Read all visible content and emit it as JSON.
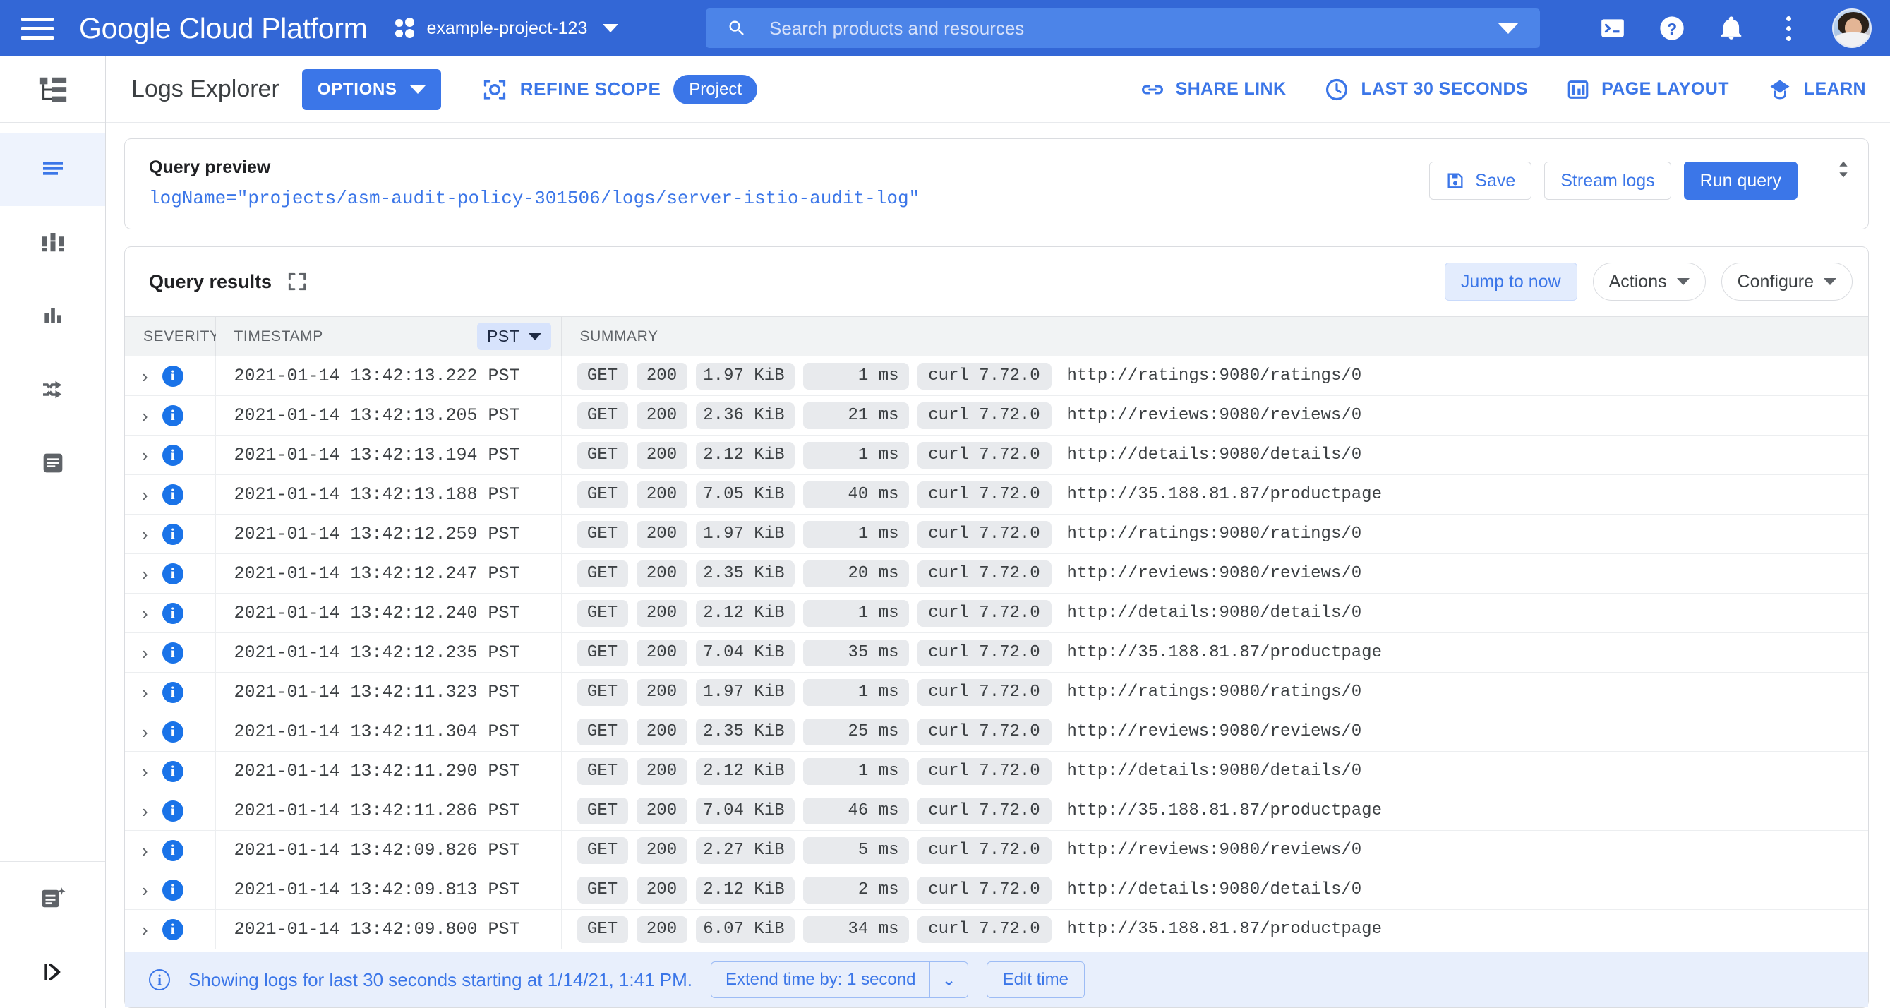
{
  "topbar": {
    "menu_icon": "hamburger-icon",
    "brand": "Google Cloud Platform",
    "project_name": "example-project-123",
    "project_icon": "project-dots-icon",
    "search": {
      "icon": "search-icon",
      "placeholder": "Search products and resources",
      "value": ""
    },
    "icons": [
      {
        "name": "cloud-shell-icon"
      },
      {
        "name": "help-icon"
      },
      {
        "name": "notifications-bell-icon"
      },
      {
        "name": "more-options-kebab-icon"
      },
      {
        "name": "user-avatar"
      }
    ]
  },
  "sidebar": {
    "top_icon": "resource-hierarchy-icon",
    "items": [
      {
        "name": "logs-explorer",
        "icon": "logs-explorer-icon",
        "active": true
      },
      {
        "name": "logs-dashboard",
        "icon": "logs-dashboard-icon",
        "active": false
      },
      {
        "name": "logs-based-metrics",
        "icon": "bar-chart-icon",
        "active": false
      },
      {
        "name": "logs-router",
        "icon": "shuffle-router-icon",
        "active": false
      },
      {
        "name": "logs-storage",
        "icon": "log-storage-icon",
        "active": false
      }
    ],
    "bottom_items": [
      {
        "name": "error-reporting",
        "icon": "document-sparkle-icon"
      },
      {
        "name": "expand-nav",
        "icon": "expand-panel-icon"
      }
    ]
  },
  "page_toolbar": {
    "title": "Logs Explorer",
    "options_button": "OPTIONS",
    "refine_scope": {
      "icon": "refine-scope-icon",
      "label": "REFINE SCOPE",
      "chip": "Project"
    },
    "actions": [
      {
        "label": "SHARE LINK",
        "icon": "link-icon"
      },
      {
        "label": "LAST 30 SECONDS",
        "icon": "clock-icon"
      },
      {
        "label": "PAGE LAYOUT",
        "icon": "page-layout-icon"
      },
      {
        "label": "LEARN",
        "icon": "learn-diamond-icon"
      }
    ]
  },
  "query_preview": {
    "title": "Query preview",
    "query": "logName=\"projects/asm-audit-policy-301506/logs/server-istio-audit-log\"",
    "save_label": "Save",
    "save_icon": "save-icon",
    "stream_label": "Stream logs",
    "run_label": "Run query",
    "resize_icon": "expand-collapse-icon"
  },
  "query_results": {
    "title": "Query results",
    "expand_icon": "fullscreen-icon",
    "jump_label": "Jump to now",
    "actions_label": "Actions",
    "configure_label": "Configure",
    "columns": {
      "severity": "SEVERITY",
      "timestamp": "TIMESTAMP",
      "timezone": "PST",
      "summary": "SUMMARY"
    },
    "rows": [
      {
        "severity": "info",
        "timestamp": "2021-01-14 13:42:13.222 PST",
        "method": "GET",
        "status": "200",
        "size": "1.97 KiB",
        "latency": "1 ms",
        "agent": "curl 7.72.0",
        "url": "http://ratings:9080/ratings/0"
      },
      {
        "severity": "info",
        "timestamp": "2021-01-14 13:42:13.205 PST",
        "method": "GET",
        "status": "200",
        "size": "2.36 KiB",
        "latency": "21 ms",
        "agent": "curl 7.72.0",
        "url": "http://reviews:9080/reviews/0"
      },
      {
        "severity": "info",
        "timestamp": "2021-01-14 13:42:13.194 PST",
        "method": "GET",
        "status": "200",
        "size": "2.12 KiB",
        "latency": "1 ms",
        "agent": "curl 7.72.0",
        "url": "http://details:9080/details/0"
      },
      {
        "severity": "info",
        "timestamp": "2021-01-14 13:42:13.188 PST",
        "method": "GET",
        "status": "200",
        "size": "7.05 KiB",
        "latency": "40 ms",
        "agent": "curl 7.72.0",
        "url": "http://35.188.81.87/productpage"
      },
      {
        "severity": "info",
        "timestamp": "2021-01-14 13:42:12.259 PST",
        "method": "GET",
        "status": "200",
        "size": "1.97 KiB",
        "latency": "1 ms",
        "agent": "curl 7.72.0",
        "url": "http://ratings:9080/ratings/0"
      },
      {
        "severity": "info",
        "timestamp": "2021-01-14 13:42:12.247 PST",
        "method": "GET",
        "status": "200",
        "size": "2.35 KiB",
        "latency": "20 ms",
        "agent": "curl 7.72.0",
        "url": "http://reviews:9080/reviews/0"
      },
      {
        "severity": "info",
        "timestamp": "2021-01-14 13:42:12.240 PST",
        "method": "GET",
        "status": "200",
        "size": "2.12 KiB",
        "latency": "1 ms",
        "agent": "curl 7.72.0",
        "url": "http://details:9080/details/0"
      },
      {
        "severity": "info",
        "timestamp": "2021-01-14 13:42:12.235 PST",
        "method": "GET",
        "status": "200",
        "size": "7.04 KiB",
        "latency": "35 ms",
        "agent": "curl 7.72.0",
        "url": "http://35.188.81.87/productpage"
      },
      {
        "severity": "info",
        "timestamp": "2021-01-14 13:42:11.323 PST",
        "method": "GET",
        "status": "200",
        "size": "1.97 KiB",
        "latency": "1 ms",
        "agent": "curl 7.72.0",
        "url": "http://ratings:9080/ratings/0"
      },
      {
        "severity": "info",
        "timestamp": "2021-01-14 13:42:11.304 PST",
        "method": "GET",
        "status": "200",
        "size": "2.35 KiB",
        "latency": "25 ms",
        "agent": "curl 7.72.0",
        "url": "http://reviews:9080/reviews/0"
      },
      {
        "severity": "info",
        "timestamp": "2021-01-14 13:42:11.290 PST",
        "method": "GET",
        "status": "200",
        "size": "2.12 KiB",
        "latency": "1 ms",
        "agent": "curl 7.72.0",
        "url": "http://details:9080/details/0"
      },
      {
        "severity": "info",
        "timestamp": "2021-01-14 13:42:11.286 PST",
        "method": "GET",
        "status": "200",
        "size": "7.04 KiB",
        "latency": "46 ms",
        "agent": "curl 7.72.0",
        "url": "http://35.188.81.87/productpage"
      },
      {
        "severity": "info",
        "timestamp": "2021-01-14 13:42:09.826 PST",
        "method": "GET",
        "status": "200",
        "size": "2.27 KiB",
        "latency": "5 ms",
        "agent": "curl 7.72.0",
        "url": "http://reviews:9080/reviews/0"
      },
      {
        "severity": "info",
        "timestamp": "2021-01-14 13:42:09.813 PST",
        "method": "GET",
        "status": "200",
        "size": "2.12 KiB",
        "latency": "2 ms",
        "agent": "curl 7.72.0",
        "url": "http://details:9080/details/0"
      },
      {
        "severity": "info",
        "timestamp": "2021-01-14 13:42:09.800 PST",
        "method": "GET",
        "status": "200",
        "size": "6.07 KiB",
        "latency": "34 ms",
        "agent": "curl 7.72.0",
        "url": "http://35.188.81.87/productpage"
      }
    ]
  },
  "status_bar": {
    "icon": "info-icon",
    "message": "Showing logs for last 30 seconds starting at 1/14/21, 1:41 PM.",
    "extend_label": "Extend time by: 1 second",
    "edit_label": "Edit time"
  },
  "colors": {
    "brand_blue": "#3367d6",
    "accent_blue": "#3b76e8",
    "info_blue": "#1a73e8",
    "pill_gray": "#e8eaed",
    "status_bg": "#e8effc"
  }
}
